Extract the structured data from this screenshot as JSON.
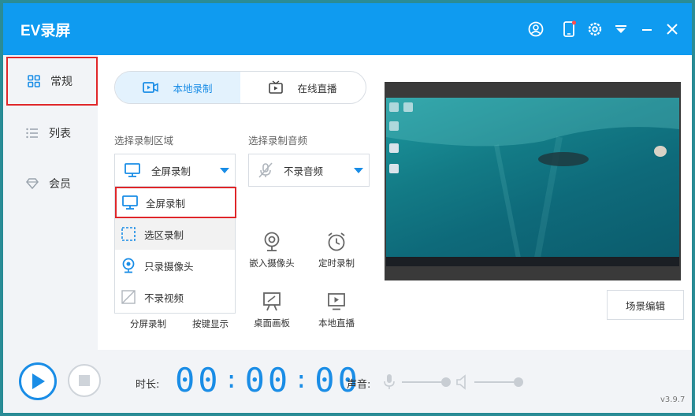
{
  "app": {
    "title": "EV录屏",
    "version": "v3.9.7"
  },
  "titlebar": {
    "icons": [
      "user-icon",
      "phone-icon",
      "settings-icon",
      "dropdown-icon",
      "minimize-icon",
      "close-icon"
    ],
    "notification_dot_color": "#ff4d4f"
  },
  "sidebar": {
    "items": [
      {
        "label": "常规",
        "icon": "grid-icon",
        "active": true
      },
      {
        "label": "列表",
        "icon": "list-icon",
        "active": false
      },
      {
        "label": "会员",
        "icon": "diamond-icon",
        "active": false
      }
    ]
  },
  "mode_tabs": [
    {
      "label": "本地录制",
      "icon": "local-record-icon",
      "active": true
    },
    {
      "label": "在线直播",
      "icon": "tv-icon",
      "active": false
    }
  ],
  "area": {
    "label": "选择录制区域",
    "selected": "全屏录制",
    "options": [
      {
        "label": "全屏录制",
        "icon": "monitor-icon"
      },
      {
        "label": "选区录制",
        "icon": "selection-icon"
      },
      {
        "label": "只录摄像头",
        "icon": "webcam-icon"
      },
      {
        "label": "不录视频",
        "icon": "no-video-icon"
      }
    ]
  },
  "audio": {
    "label": "选择录制音频",
    "selected": "不录音频"
  },
  "tools": [
    {
      "label": "嵌入摄像头",
      "icon": "webcam-icon"
    },
    {
      "label": "定时录制",
      "icon": "alarm-clock-icon"
    },
    {
      "label": "桌面画板",
      "icon": "easel-icon"
    },
    {
      "label": "本地直播",
      "icon": "play-screen-icon"
    }
  ],
  "hidden_tools": [
    {
      "label": "分屏录制"
    },
    {
      "label": "按键显示"
    }
  ],
  "preview": {
    "scene_button": "场景编辑"
  },
  "footer": {
    "duration_label": "时长:",
    "time": {
      "hours": "00",
      "minutes": "00",
      "seconds": "00"
    },
    "sound_label": "声音:",
    "mic_volume": 1.0,
    "speaker_volume": 1.0
  },
  "colors": {
    "accent": "#1a8de6",
    "titlebar": "#0f9bf0",
    "highlight": "#e0282b"
  }
}
